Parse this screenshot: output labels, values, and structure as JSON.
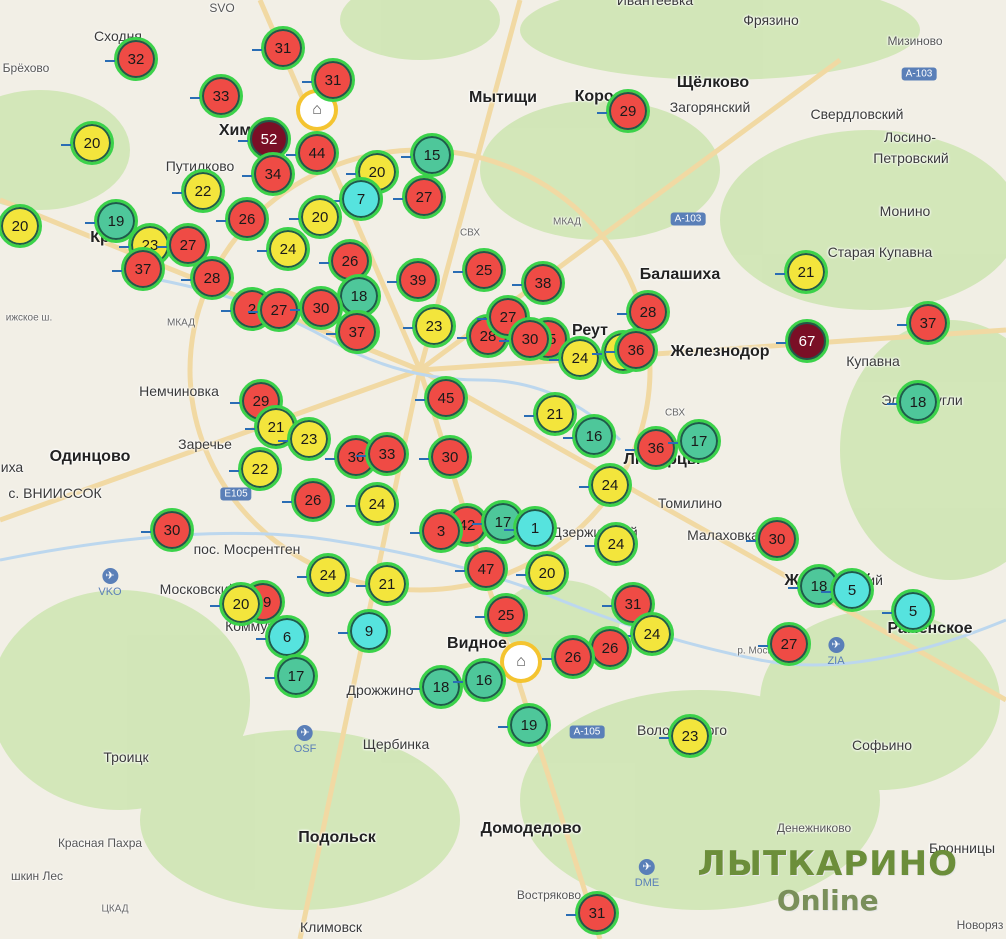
{
  "map": {
    "labels": [
      {
        "text": "Сходня",
        "cls": "lbl"
      },
      {
        "text": "SVO",
        "cls": "lbl sm"
      },
      {
        "text": "Ивантеевка",
        "cls": "lbl"
      },
      {
        "text": "Фрязино",
        "cls": "lbl"
      },
      {
        "text": "Мизиново",
        "cls": "lbl sm"
      },
      {
        "text": "Брёхово",
        "cls": "lbl sm"
      },
      {
        "text": "Мытищи",
        "cls": "lbl big"
      },
      {
        "text": "Корол",
        "cls": "lbl big"
      },
      {
        "text": "Щёлково",
        "cls": "lbl big"
      },
      {
        "text": "Загорянский",
        "cls": "lbl"
      },
      {
        "text": "Свердловский",
        "cls": "lbl"
      },
      {
        "text": "Лосино-",
        "cls": "lbl"
      },
      {
        "text": "Петровский",
        "cls": "lbl"
      },
      {
        "text": "Хим",
        "cls": "lbl big"
      },
      {
        "text": "Путилково",
        "cls": "lbl"
      },
      {
        "text": "Монино",
        "cls": "lbl"
      },
      {
        "text": "Кр",
        "cls": "lbl big"
      },
      {
        "text": "Старая Купавна",
        "cls": "lbl"
      },
      {
        "text": "Балашиха",
        "cls": "lbl big"
      },
      {
        "text": "Реут",
        "cls": "lbl big"
      },
      {
        "text": "Железнодор",
        "cls": "lbl big"
      },
      {
        "text": "Купавна",
        "cls": "lbl"
      },
      {
        "text": "Электроугли",
        "cls": "lbl"
      },
      {
        "text": "Немчиновка",
        "cls": "lbl"
      },
      {
        "text": "Заречье",
        "cls": "lbl"
      },
      {
        "text": "Одинцово",
        "cls": "lbl big"
      },
      {
        "text": "иха",
        "cls": "lbl"
      },
      {
        "text": "с. ВНИИССОК",
        "cls": "lbl"
      },
      {
        "text": "Люберцы",
        "cls": "lbl big"
      },
      {
        "text": "Томилино",
        "cls": "lbl"
      },
      {
        "text": "Дзержинский",
        "cls": "lbl"
      },
      {
        "text": "Малаховка",
        "cls": "lbl"
      },
      {
        "text": "пос. Мосрентген",
        "cls": "lbl"
      },
      {
        "text": "Московский",
        "cls": "lbl"
      },
      {
        "text": "Коммунарка",
        "cls": "lbl"
      },
      {
        "text": "Раменское",
        "cls": "lbl big"
      },
      {
        "text": "Жуковский",
        "cls": "lbl big"
      },
      {
        "text": "Видное",
        "cls": "lbl big"
      },
      {
        "text": "Дрожжино",
        "cls": "lbl"
      },
      {
        "text": "Щербинка",
        "cls": "lbl"
      },
      {
        "text": "Троицк",
        "cls": "lbl"
      },
      {
        "text": "Володарского",
        "cls": "lbl"
      },
      {
        "text": "Софьино",
        "cls": "lbl"
      },
      {
        "text": "Подольск",
        "cls": "lbl big"
      },
      {
        "text": "Домодедово",
        "cls": "lbl big"
      },
      {
        "text": "Денежниково",
        "cls": "lbl sm"
      },
      {
        "text": "Бронницы",
        "cls": "lbl"
      },
      {
        "text": "Красная Пахра",
        "cls": "lbl sm"
      },
      {
        "text": "шкин Лес",
        "cls": "lbl sm"
      },
      {
        "text": "ЦКАД",
        "cls": "lbl road"
      },
      {
        "text": "Климовск",
        "cls": "lbl"
      },
      {
        "text": "Востряково",
        "cls": "lbl sm"
      },
      {
        "text": "Новоряз",
        "cls": "lbl sm"
      },
      {
        "text": "МКАД",
        "cls": "lbl road"
      },
      {
        "text": "СВХ",
        "cls": "lbl road"
      },
      {
        "text": "СВХ",
        "cls": "lbl road"
      },
      {
        "text": "МКАД",
        "cls": "lbl road"
      },
      {
        "text": "ижское ш.",
        "cls": "lbl road"
      },
      {
        "text": "р. Москва",
        "cls": "lbl road"
      },
      {
        "text": "кий",
        "cls": "lbl"
      }
    ],
    "shields": [
      "A-103",
      "A-103",
      "E105",
      "A-105"
    ],
    "airports": [
      "VKO",
      "OSF",
      "ZIA",
      "DME"
    ]
  },
  "markers": [
    {
      "v": "32",
      "c": "red"
    },
    {
      "v": "31",
      "c": "red"
    },
    {
      "v": "31",
      "c": "red"
    },
    {
      "v": "33",
      "c": "red"
    },
    {
      "v": "20",
      "c": "yellow"
    },
    {
      "v": "52",
      "c": "maroon"
    },
    {
      "v": "44",
      "c": "red"
    },
    {
      "v": "34",
      "c": "red"
    },
    {
      "v": "15",
      "c": "teal"
    },
    {
      "v": "20",
      "c": "yellow"
    },
    {
      "v": "7",
      "c": "cyan"
    },
    {
      "v": "27",
      "c": "red"
    },
    {
      "v": "22",
      "c": "yellow"
    },
    {
      "v": "20",
      "c": "yellow"
    },
    {
      "v": "19",
      "c": "teal"
    },
    {
      "v": "26",
      "c": "red"
    },
    {
      "v": "20",
      "c": "yellow"
    },
    {
      "v": "23",
      "c": "yellow"
    },
    {
      "v": "27",
      "c": "red"
    },
    {
      "v": "24",
      "c": "yellow"
    },
    {
      "v": "37",
      "c": "red"
    },
    {
      "v": "28",
      "c": "red"
    },
    {
      "v": "26",
      "c": "red"
    },
    {
      "v": "39",
      "c": "red"
    },
    {
      "v": "25",
      "c": "red"
    },
    {
      "v": "38",
      "c": "red"
    },
    {
      "v": "29",
      "c": "red"
    },
    {
      "v": "18",
      "c": "teal"
    },
    {
      "v": "2",
      "c": "red"
    },
    {
      "v": "27",
      "c": "red"
    },
    {
      "v": "30",
      "c": "red"
    },
    {
      "v": "37",
      "c": "red"
    },
    {
      "v": "23",
      "c": "yellow"
    },
    {
      "v": "28",
      "c": "red"
    },
    {
      "v": "27",
      "c": "red"
    },
    {
      "v": "25",
      "c": "red"
    },
    {
      "v": "24",
      "c": "yellow"
    },
    {
      "v": "24",
      "c": "yellow"
    },
    {
      "v": "28",
      "c": "red"
    },
    {
      "v": "36",
      "c": "red"
    },
    {
      "v": "21",
      "c": "yellow"
    },
    {
      "v": "67",
      "c": "maroon"
    },
    {
      "v": "37",
      "c": "red"
    },
    {
      "v": "18",
      "c": "teal"
    },
    {
      "v": "29",
      "c": "red"
    },
    {
      "v": "45",
      "c": "red"
    },
    {
      "v": "21",
      "c": "yellow"
    },
    {
      "v": "23",
      "c": "yellow"
    },
    {
      "v": "21",
      "c": "yellow"
    },
    {
      "v": "16",
      "c": "teal"
    },
    {
      "v": "36",
      "c": "red"
    },
    {
      "v": "17",
      "c": "teal"
    },
    {
      "v": "36",
      "c": "red"
    },
    {
      "v": "33",
      "c": "red"
    },
    {
      "v": "30",
      "c": "red"
    },
    {
      "v": "22",
      "c": "yellow"
    },
    {
      "v": "26",
      "c": "red"
    },
    {
      "v": "24",
      "c": "yellow"
    },
    {
      "v": "24",
      "c": "yellow"
    },
    {
      "v": "30",
      "c": "red"
    },
    {
      "v": "42",
      "c": "red"
    },
    {
      "v": "17",
      "c": "teal"
    },
    {
      "v": "1",
      "c": "cyan"
    },
    {
      "v": "24",
      "c": "yellow"
    },
    {
      "v": "30",
      "c": "red"
    },
    {
      "v": "24",
      "c": "yellow"
    },
    {
      "v": "21",
      "c": "yellow"
    },
    {
      "v": "47",
      "c": "red"
    },
    {
      "v": "20",
      "c": "yellow"
    },
    {
      "v": "29",
      "c": "red"
    },
    {
      "v": "18",
      "c": "teal"
    },
    {
      "v": "5",
      "c": "cyan"
    },
    {
      "v": "6",
      "c": "cyan"
    },
    {
      "v": "9",
      "c": "cyan"
    },
    {
      "v": "25",
      "c": "red"
    },
    {
      "v": "31",
      "c": "red"
    },
    {
      "v": "5",
      "c": "cyan"
    },
    {
      "v": "24",
      "c": "yellow"
    },
    {
      "v": "27",
      "c": "red"
    },
    {
      "v": "26",
      "c": "red"
    },
    {
      "v": "26",
      "c": "red"
    },
    {
      "v": "17",
      "c": "teal"
    },
    {
      "v": "18",
      "c": "teal"
    },
    {
      "v": "16",
      "c": "teal"
    },
    {
      "v": "19",
      "c": "teal"
    },
    {
      "v": "23",
      "c": "yellow"
    },
    {
      "v": "31",
      "c": "red"
    },
    {
      "v": "20",
      "c": "yellow"
    },
    {
      "v": "37",
      "c": "red"
    },
    {
      "v": "3",
      "c": "red"
    },
    {
      "v": "30",
      "c": "red"
    }
  ],
  "factories": [
    "factory-icon",
    "factory-icon"
  ],
  "watermark": {
    "line1": "ЛЫТКАРИНО",
    "line2": "Online"
  },
  "colors": {
    "red": "#ef4b45",
    "yellow": "#f3e53c",
    "teal": "#4ec79a",
    "cyan": "#56e3de",
    "maroon": "#7a0f26",
    "ring": "#3bd24a"
  }
}
